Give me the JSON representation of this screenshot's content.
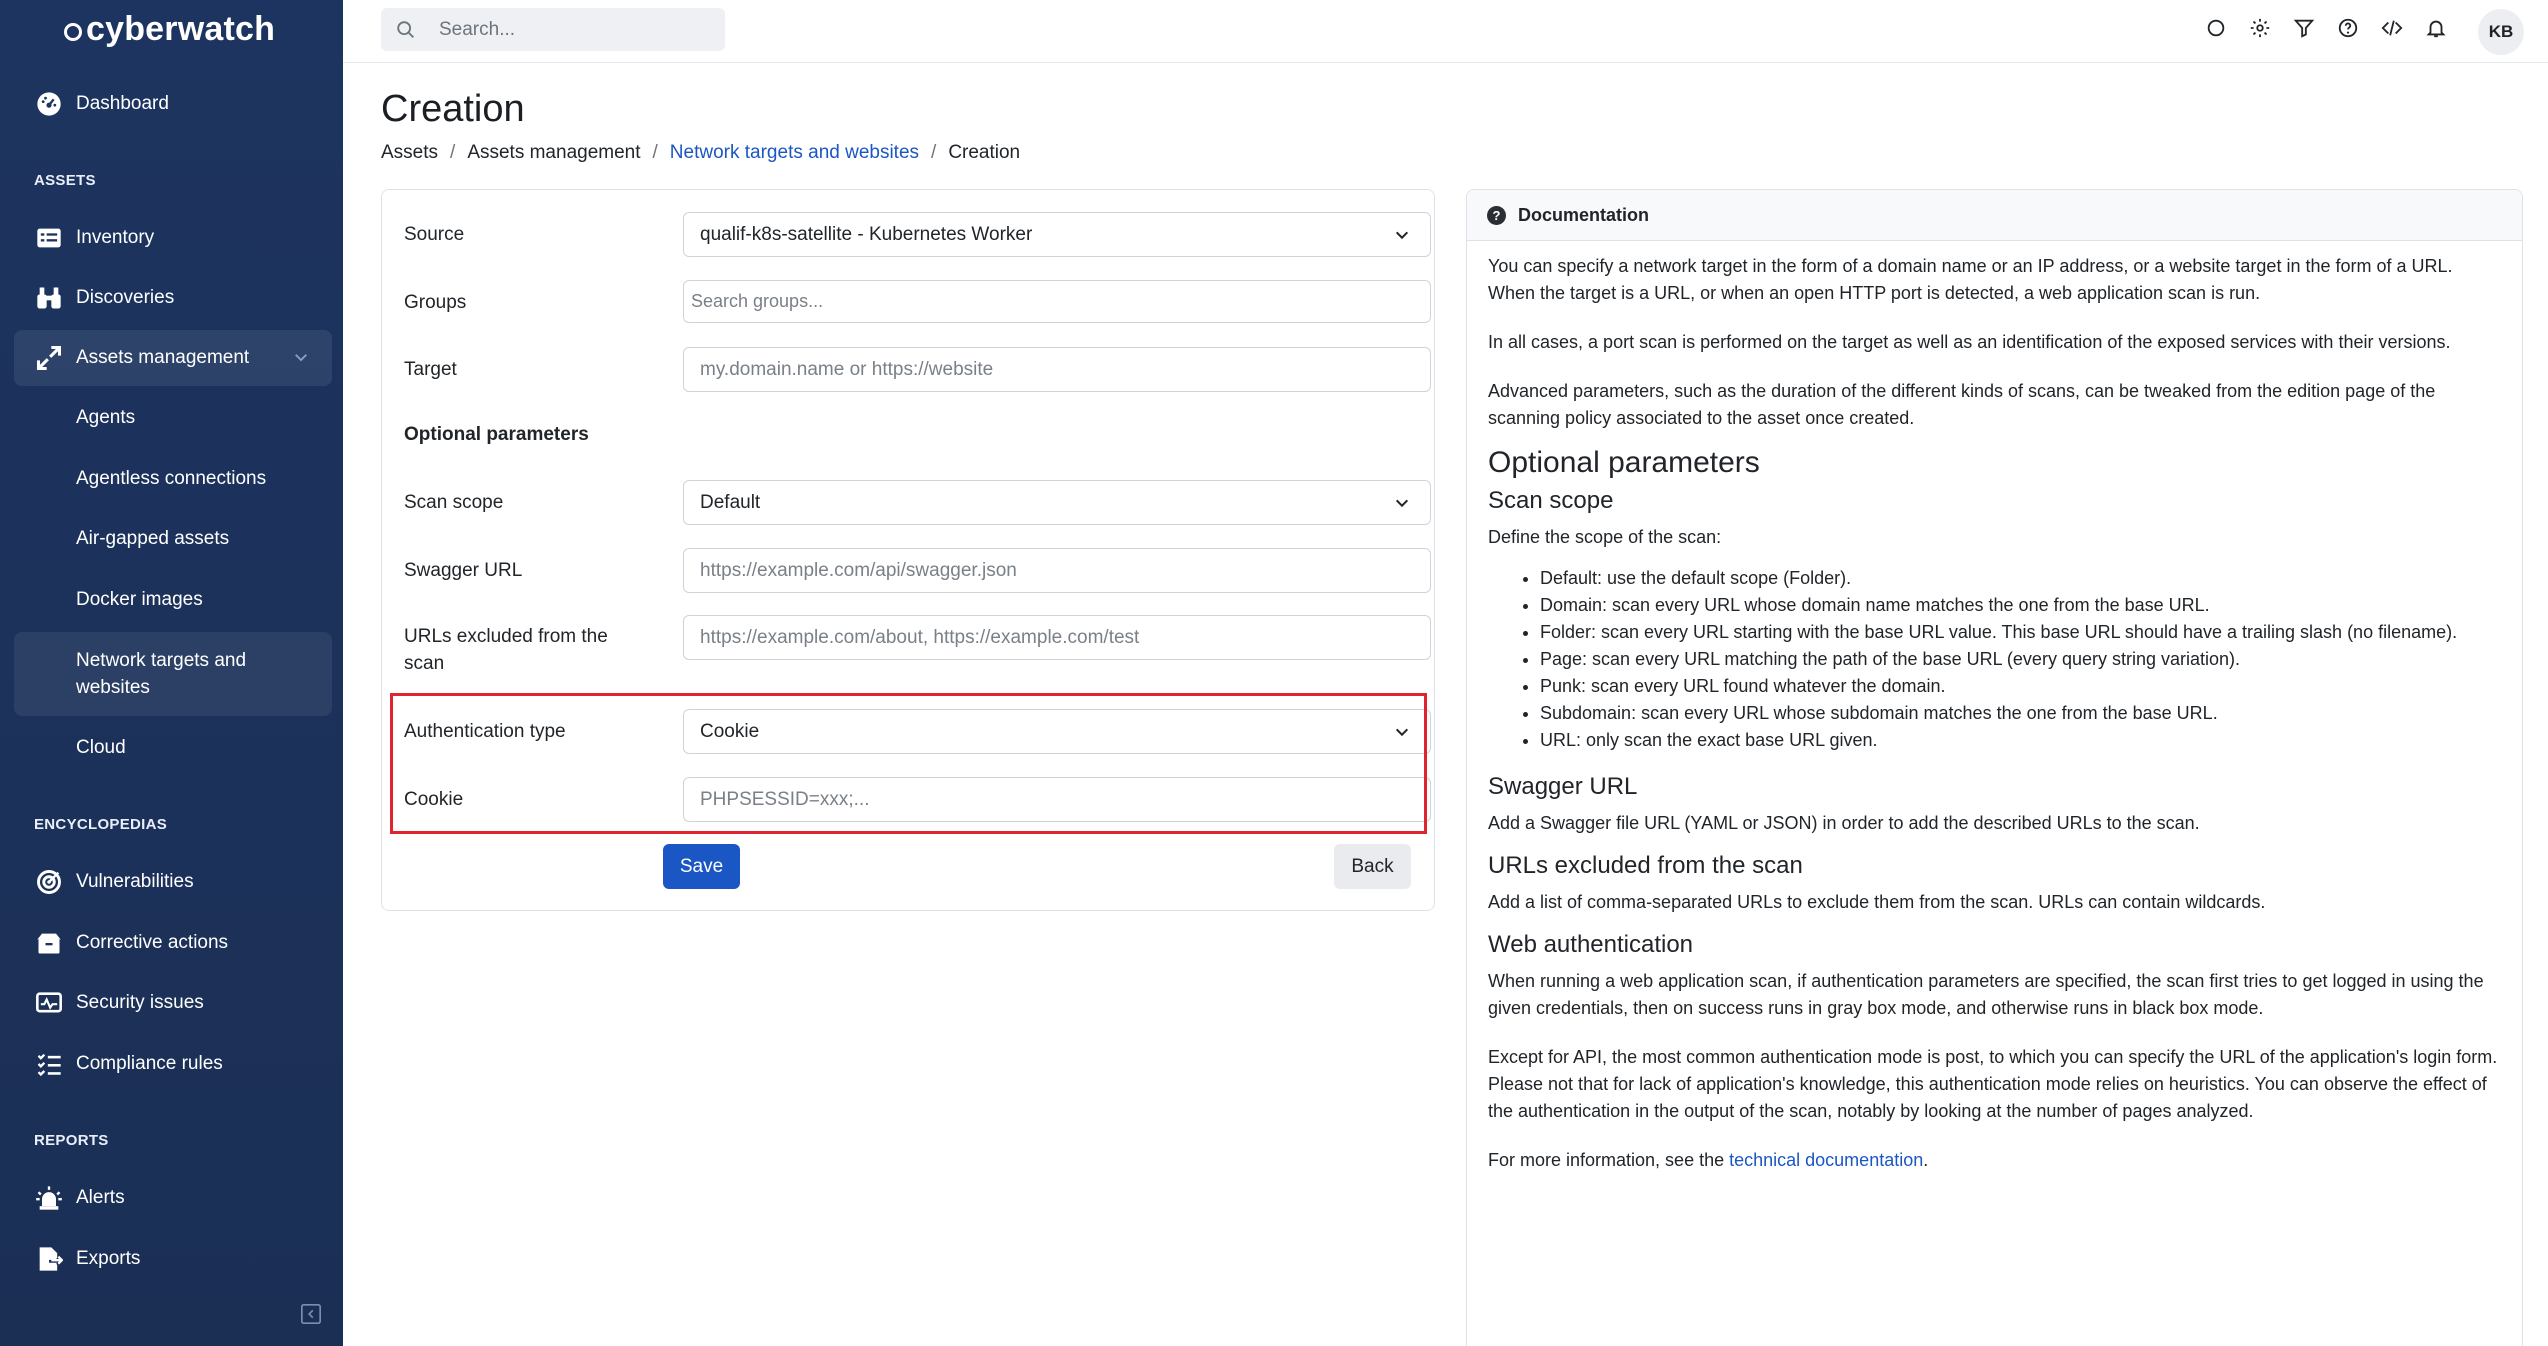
{
  "app": {
    "logo": "cyberwatch"
  },
  "sidebar": {
    "dashboard": "Dashboard",
    "sections": {
      "assets": "ASSETS",
      "encyclopedias": "ENCYCLOPEDIAS",
      "reports": "REPORTS"
    },
    "items": {
      "inventory": "Inventory",
      "discoveries": "Discoveries",
      "assets_management": "Assets management",
      "agents": "Agents",
      "agentless": "Agentless connections",
      "airgapped": "Air-gapped assets",
      "docker": "Docker images",
      "network_targets": "Network targets and websites",
      "cloud": "Cloud",
      "vulnerabilities": "Vulnerabilities",
      "corrective": "Corrective actions",
      "security_issues": "Security issues",
      "compliance": "Compliance rules",
      "alerts": "Alerts",
      "exports": "Exports"
    }
  },
  "topbar": {
    "search_placeholder": "Search...",
    "avatar": "KB"
  },
  "page": {
    "title": "Creation",
    "breadcrumb": [
      "Assets",
      "Assets management",
      "Network targets and websites",
      "Creation"
    ]
  },
  "form": {
    "source": {
      "label": "Source",
      "value": "qualif-k8s-satellite - Kubernetes Worker"
    },
    "groups": {
      "label": "Groups",
      "placeholder": "Search groups..."
    },
    "target": {
      "label": "Target",
      "placeholder": "my.domain.name or https://website"
    },
    "optional_heading": "Optional parameters",
    "scan_scope": {
      "label": "Scan scope",
      "value": "Default"
    },
    "swagger": {
      "label": "Swagger URL",
      "placeholder": "https://example.com/api/swagger.json"
    },
    "excluded": {
      "label": "URLs excluded from the scan",
      "placeholder": "https://example.com/about, https://example.com/test"
    },
    "auth_type": {
      "label": "Authentication type",
      "value": "Cookie"
    },
    "cookie": {
      "label": "Cookie",
      "placeholder": "PHPSESSID=xxx;..."
    },
    "save": "Save",
    "back": "Back"
  },
  "doc": {
    "title": "Documentation",
    "p1": "You can specify a network target in the form of a domain name or an IP address, or a website target in the form of a URL. When the target is a URL, or when an open HTTP port is detected, a web application scan is run.",
    "p2": "In all cases, a port scan is performed on the target as well as an identification of the exposed services with their versions.",
    "p3": "Advanced parameters, such as the duration of the different kinds of scans, can be tweaked from the edition page of the scanning policy associated to the asset once created.",
    "h_optional": "Optional parameters",
    "h_scope": "Scan scope",
    "scope_intro": "Define the scope of the scan:",
    "scope_items": [
      "Default: use the default scope (Folder).",
      "Domain: scan every URL whose domain name matches the one from the base URL.",
      "Folder: scan every URL starting with the base URL value. This base URL should have a trailing slash (no filename).",
      "Page: scan every URL matching the path of the base URL (every query string variation).",
      "Punk: scan every URL found whatever the domain.",
      "Subdomain: scan every URL whose subdomain matches the one from the base URL.",
      "URL: only scan the exact base URL given."
    ],
    "h_swagger": "Swagger URL",
    "swagger_text": "Add a Swagger file URL (YAML or JSON) in order to add the described URLs to the scan.",
    "h_excluded": "URLs excluded from the scan",
    "excluded_text": "Add a list of comma-separated URLs to exclude them from the scan. URLs can contain wildcards.",
    "h_webauth": "Web authentication",
    "webauth_p1": "When running a web application scan, if authentication parameters are specified, the scan first tries to get logged in using the given credentials, then on success runs in gray box mode, and otherwise runs in black box mode.",
    "webauth_p2": "Except for API, the most common authentication mode is post, to which you can specify the URL of the application's login form. Please not that for lack of application's knowledge, this authentication mode relies on heuristics. You can observe the effect of the authentication in the output of the scan, notably by looking at the number of pages analyzed.",
    "more_prefix": "For more information, see the ",
    "more_link": "technical documentation",
    "more_suffix": "."
  },
  "colors": {
    "sidebar": "#1d3460",
    "primary": "#1a56c4",
    "highlight": "#e0232e"
  }
}
